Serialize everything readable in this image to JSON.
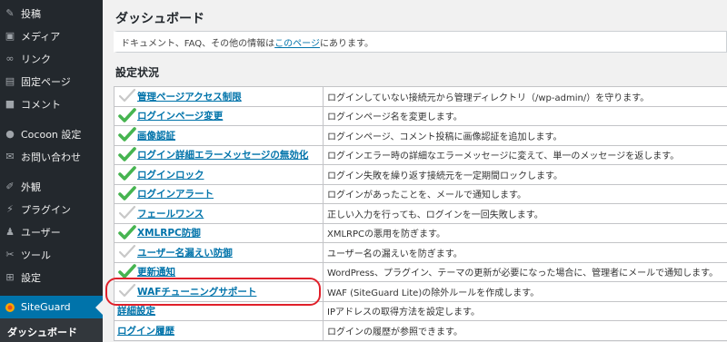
{
  "sidebar": {
    "items": [
      {
        "label": "投稿",
        "icon": "pin-icon"
      },
      {
        "label": "メディア",
        "icon": "media-icon"
      },
      {
        "label": "リンク",
        "icon": "link-icon"
      },
      {
        "label": "固定ページ",
        "icon": "page-icon"
      },
      {
        "label": "コメント",
        "icon": "comment-icon"
      },
      {
        "label": "Cocoon 設定",
        "icon": "cocoon-icon"
      },
      {
        "label": "お問い合わせ",
        "icon": "mail-icon"
      },
      {
        "label": "外観",
        "icon": "appearance-icon"
      },
      {
        "label": "プラグイン",
        "icon": "plugin-icon"
      },
      {
        "label": "ユーザー",
        "icon": "user-icon"
      },
      {
        "label": "ツール",
        "icon": "tool-icon"
      },
      {
        "label": "設定",
        "icon": "settings-icon"
      },
      {
        "label": "SiteGuard",
        "icon": "siteguard-icon"
      },
      {
        "label": "ダッシュボード",
        "icon": ""
      }
    ]
  },
  "main": {
    "title": "ダッシュボード",
    "notice": {
      "prefix": "ドキュメント、FAQ、その他の情報は ",
      "link": "このページ",
      "suffix": " にあります。"
    },
    "section_title": "設定状況",
    "rows": [
      {
        "feature": "管理ページアクセス制限",
        "desc": "ログインしていない接続元から管理ディレクトリ（/wp-admin/）を守ります。",
        "status": "off"
      },
      {
        "feature": "ログインページ変更",
        "desc": "ログインページ名を変更します。",
        "status": "on"
      },
      {
        "feature": "画像認証",
        "desc": "ログインページ、コメント投稿に画像認証を追加します。",
        "status": "on"
      },
      {
        "feature": "ログイン詳細エラーメッセージの無効化",
        "desc": "ログインエラー時の詳細なエラーメッセージに変えて、単一のメッセージを返します。",
        "status": "on"
      },
      {
        "feature": "ログインロック",
        "desc": "ログイン失敗を繰り返す接続元を一定期間ロックします。",
        "status": "on"
      },
      {
        "feature": "ログインアラート",
        "desc": "ログインがあったことを、メールで通知します。",
        "status": "on"
      },
      {
        "feature": "フェールワンス",
        "desc": "正しい入力を行っても、ログインを一回失敗します。",
        "status": "off"
      },
      {
        "feature": "XMLRPC防御",
        "desc": "XMLRPCの悪用を防ぎます。",
        "status": "on"
      },
      {
        "feature": "ユーザー名漏えい防御",
        "desc": "ユーザー名の漏えいを防ぎます。",
        "status": "off"
      },
      {
        "feature": "更新通知",
        "desc": "WordPress、プラグイン、テーマの更新が必要になった場合に、管理者にメールで通知します。",
        "status": "on"
      },
      {
        "feature": "WAFチューニングサポート",
        "desc": "WAF (SiteGuard Lite)の除外ルールを作成します。",
        "status": "off"
      },
      {
        "feature": "詳細設定",
        "desc": "IPアドレスの取得方法を設定します。",
        "status": "none"
      },
      {
        "feature": "ログイン履歴",
        "desc": "ログインの履歴が参照できます。",
        "status": "none"
      }
    ]
  },
  "colors": {
    "accent": "#0073aa",
    "check_on": "#46b450",
    "check_off": "#c8c8c8",
    "highlight": "#e0202a"
  }
}
